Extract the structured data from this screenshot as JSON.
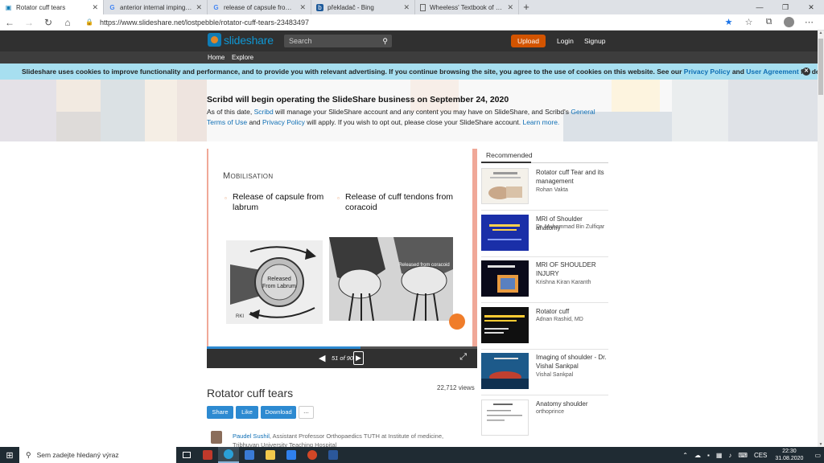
{
  "browser": {
    "tabs": [
      {
        "title": "Rotator cuff tears",
        "active": true,
        "icon": "slideshare-icon"
      },
      {
        "title": "anterior internal impingement",
        "active": false,
        "icon": "google-icon"
      },
      {
        "title": "release of capsule from labrum",
        "active": false,
        "icon": "google-icon"
      },
      {
        "title": "překladač - Bing",
        "active": false,
        "icon": "bing-icon"
      },
      {
        "title": "Wheeless' Textbook of Orthopaedics",
        "active": false,
        "icon": "page-icon"
      }
    ],
    "url": "https://www.slideshare.net/lostpebble/rotator-cuff-tears-23483497"
  },
  "site": {
    "logo_text": "slideshare",
    "search_placeholder": "Search",
    "upload_label": "Upload",
    "login_label": "Login",
    "signup_label": "Signup",
    "nav": [
      "Home",
      "Explore"
    ]
  },
  "cookie": {
    "text_before": "Slideshare uses cookies to improve functionality and performance, and to provide you with relevant advertising. If you continue browsing the site, you agree to the use of cookies on this website. See our ",
    "privacy_link": "Privacy Policy",
    "and": " and ",
    "agreement_link": "User Agreement",
    "text_after": " for details."
  },
  "banner": {
    "title": "Scribd will begin operating the SlideShare business on September 24, 2020",
    "t1": "As of this date, ",
    "scribd": "Scribd",
    "t2": " will manage your SlideShare account and any content you may have on SlideShare, and Scribd's ",
    "terms": "General Terms of Use",
    "t3": " and ",
    "privacy": "Privacy Policy",
    "t4": " will apply. If you wish to opt out, please close your SlideShare account. ",
    "learn": "Learn more."
  },
  "slide": {
    "title": "Mobilisation",
    "bullet1": "Release of capsule from labrum",
    "bullet2": "Release of cuff tendons from coracoid",
    "img1_label": "Released From Labrum",
    "img1_sig": "RKI",
    "img2_label": "Released from coracoid"
  },
  "player": {
    "page_label": "51 of 90",
    "progress": 0.567
  },
  "doc": {
    "title": "Rotator cuff tears",
    "views": "22,712 views",
    "share": "Share",
    "like": "Like",
    "download": "Download",
    "more": "...",
    "author_name": "Paudel Sushil",
    "author_desc": ", Assistant Professor Orthopaedics TUTH at Institute of medicine, Tribhuvan University Teaching Hospital"
  },
  "recommended": {
    "heading": "Recommended",
    "items": [
      {
        "title": "Rotator cuff Tear and its management",
        "author": "Rohan Vakta"
      },
      {
        "title": "MRI of Shoulder anatomy",
        "author": "Dr. Muhammad Bin Zulfiqar"
      },
      {
        "title": "MRI OF SHOULDER INJURY",
        "author": "Krishna Kiran Karanth"
      },
      {
        "title": "Rotator cuff",
        "author": "Adnan Rashid, MD"
      },
      {
        "title": "Imaging of shoulder - Dr. Vishal Sankpal",
        "author": "Vishal Sankpal"
      },
      {
        "title": "Anatomy shoulder",
        "author": "orthoprince"
      }
    ]
  },
  "taskbar": {
    "search_text": "Sem zadejte hledaný výraz",
    "lang": "CES",
    "time": "22:30",
    "date": "31.08.2020"
  },
  "colors": {
    "accent": "#2d8ad1",
    "upload": "#d35400",
    "cookie_bg": "#a7dff0"
  }
}
